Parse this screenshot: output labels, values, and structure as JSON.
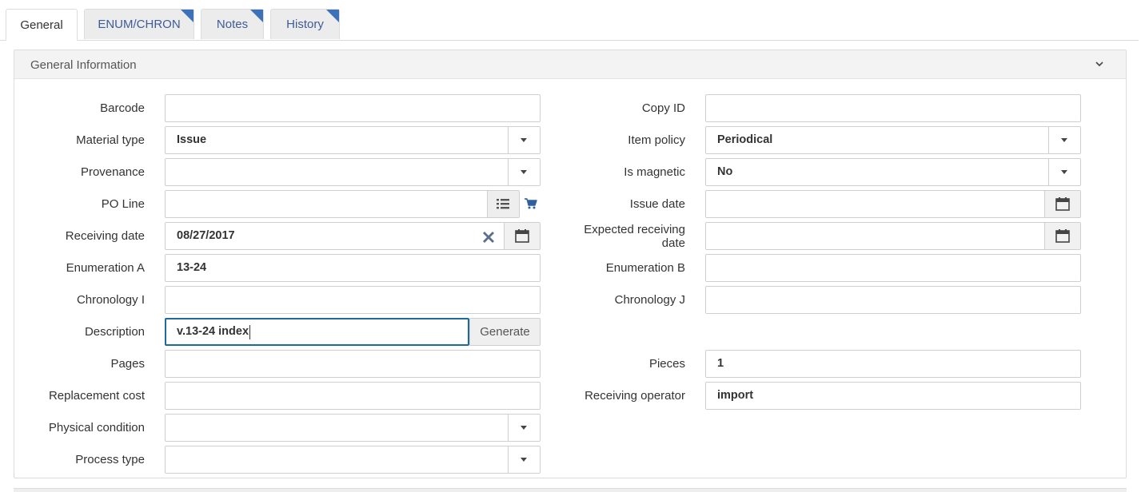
{
  "tabs": [
    {
      "label": "General",
      "active": true
    },
    {
      "label": "ENUM/CHRON",
      "active": false
    },
    {
      "label": "Notes",
      "active": false
    },
    {
      "label": "History",
      "active": false
    }
  ],
  "panel": {
    "title": "General Information"
  },
  "left": {
    "barcode": {
      "label": "Barcode",
      "value": ""
    },
    "material_type": {
      "label": "Material type",
      "value": "Issue"
    },
    "provenance": {
      "label": "Provenance",
      "value": ""
    },
    "po_line": {
      "label": "PO Line",
      "value": ""
    },
    "receiving_date": {
      "label": "Receiving date",
      "value": "08/27/2017"
    },
    "enumeration_a": {
      "label": "Enumeration A",
      "value": "13-24"
    },
    "chronology_i": {
      "label": "Chronology I",
      "value": ""
    },
    "description": {
      "label": "Description",
      "value": "v.13-24 index",
      "generate_label": "Generate"
    },
    "pages": {
      "label": "Pages",
      "value": ""
    },
    "replacement_cost": {
      "label": "Replacement cost",
      "value": ""
    },
    "physical_condition": {
      "label": "Physical condition",
      "value": ""
    },
    "process_type": {
      "label": "Process type",
      "value": ""
    }
  },
  "right": {
    "copy_id": {
      "label": "Copy ID",
      "value": ""
    },
    "item_policy": {
      "label": "Item policy",
      "value": "Periodical"
    },
    "is_magnetic": {
      "label": "Is magnetic",
      "value": "No"
    },
    "issue_date": {
      "label": "Issue date",
      "value": ""
    },
    "expected_receiving_date": {
      "label_line1": "Expected receiving",
      "label_line2": "date",
      "value": ""
    },
    "enumeration_b": {
      "label": "Enumeration B",
      "value": ""
    },
    "chronology_j": {
      "label": "Chronology J",
      "value": ""
    },
    "pieces": {
      "label": "Pieces",
      "value": "1"
    },
    "receiving_operator": {
      "label": "Receiving operator",
      "value": "import"
    }
  },
  "colors": {
    "accent": "#3d72b8",
    "focus": "#1d6a9c",
    "tab_text": "#3e5c97"
  }
}
